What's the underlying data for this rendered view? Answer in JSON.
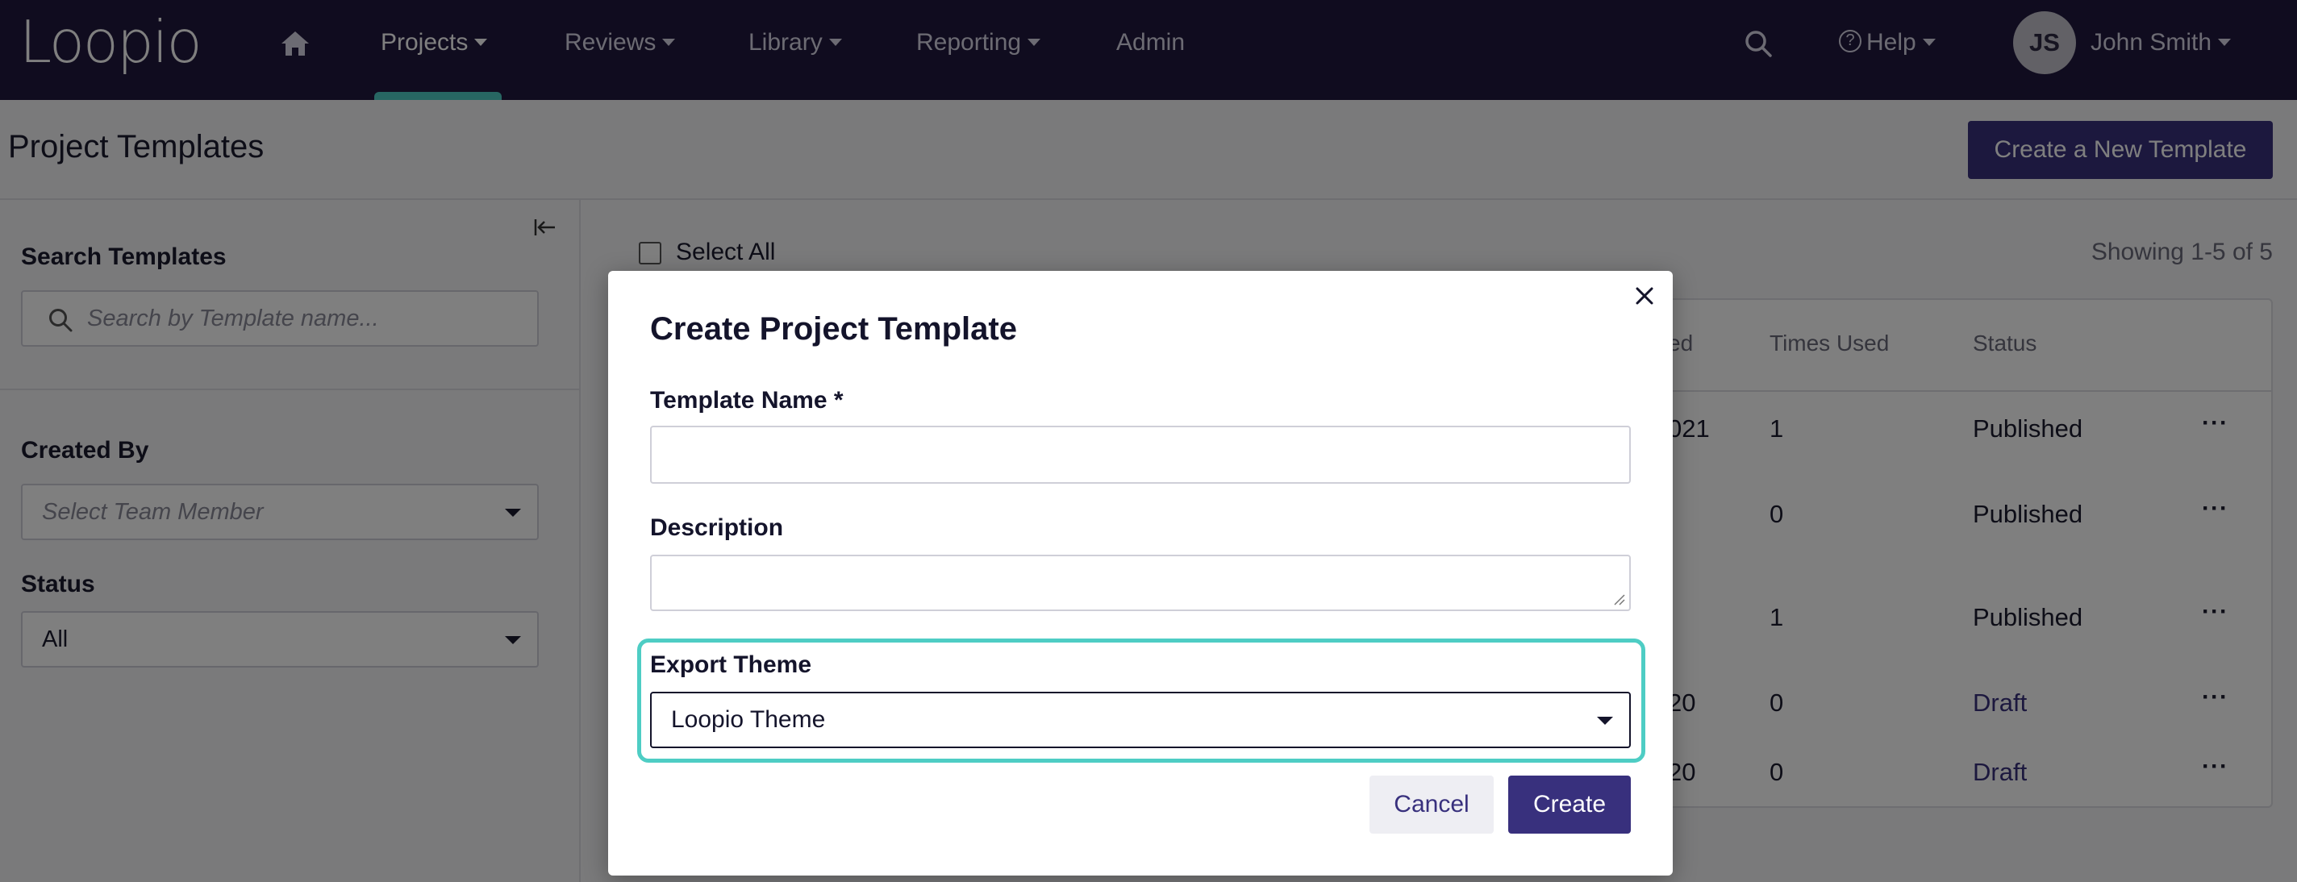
{
  "nav": {
    "logo": "Loopio",
    "items": [
      {
        "label": "Projects",
        "active": true
      },
      {
        "label": "Reviews"
      },
      {
        "label": "Library"
      },
      {
        "label": "Reporting"
      },
      {
        "label": "Admin"
      }
    ],
    "help_label": "Help",
    "user_initials": "JS",
    "user_name": "John Smith"
  },
  "page": {
    "title": "Project Templates",
    "create_button": "Create a New Template"
  },
  "sidebar": {
    "search_label": "Search Templates",
    "search_placeholder": "Search by Template name...",
    "created_by_label": "Created By",
    "created_by_placeholder": "Select Team Member",
    "status_label": "Status",
    "status_value": "All"
  },
  "list": {
    "select_all": "Select All",
    "showing": "Showing 1-5 of 5",
    "columns": {
      "created_partial": "ed",
      "times_used": "Times Used",
      "status": "Status"
    },
    "rows": [
      {
        "date_partial": "021",
        "times_used": "1",
        "status": "Published"
      },
      {
        "date_partial": "",
        "times_used": "0",
        "status": "Published"
      },
      {
        "date_partial": "",
        "times_used": "1",
        "status": "Published"
      },
      {
        "date_partial": "20",
        "times_used": "0",
        "status": "Draft"
      },
      {
        "date_partial": "20",
        "times_used": "0",
        "status": "Draft"
      }
    ],
    "more_label": "···"
  },
  "modal": {
    "title": "Create Project Template",
    "name_label": "Template Name *",
    "name_value": "",
    "description_label": "Description",
    "description_value": "",
    "theme_label": "Export Theme",
    "theme_value": "Loopio Theme",
    "cancel": "Cancel",
    "create": "Create"
  },
  "colors": {
    "nav_bg": "#21183f",
    "primary": "#38307d",
    "accent": "#4ecdc4"
  }
}
